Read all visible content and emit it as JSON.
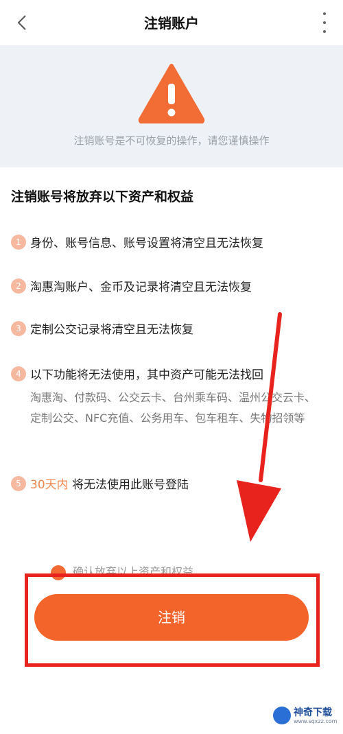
{
  "header": {
    "title": "注销账户"
  },
  "warning": {
    "text": "注销账号是不可恢复的操作，请您谨慎操作"
  },
  "section": {
    "title": "注销账号将放弃以下资产和权益"
  },
  "items": [
    {
      "num": "1",
      "text": "身份、账号信息、账号设置将清空且无法恢复"
    },
    {
      "num": "2",
      "text": "淘惠淘账户、金币及记录将清空且无法恢复"
    },
    {
      "num": "3",
      "text": "定制公交记录将清空且无法恢复"
    },
    {
      "num": "4",
      "text": "以下功能将无法使用，其中资产可能无法找回",
      "sub": "淘惠淘、付款码、公交云卡、台州乘车码、温州公交云卡、定制公交、NFC充值、公务用车、包车租车、失物招领等"
    },
    {
      "num": "5",
      "highlight": "30天内",
      "text": "将无法使用此账号登陆"
    }
  ],
  "confirm": {
    "text": "确认放弃以上资产和权益"
  },
  "action": {
    "cancel_label": "注销"
  },
  "watermark": {
    "title": "神奇下载",
    "url": "www.sqxzz.com"
  },
  "colors": {
    "accent": "#f3642b",
    "annotation": "#e8231e",
    "panel": "#eef2f7"
  }
}
